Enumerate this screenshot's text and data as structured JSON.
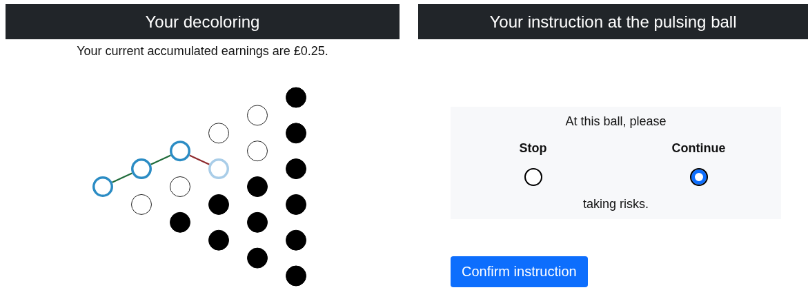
{
  "left_panel": {
    "title": "Your decoloring",
    "earnings": "Your current accumulated earnings are £0.25.",
    "ball_columns": [
      [
        {
          "kind": "path"
        }
      ],
      [
        {
          "kind": "path"
        },
        {
          "kind": "open"
        }
      ],
      [
        {
          "kind": "path"
        },
        {
          "kind": "open"
        },
        {
          "kind": "filled"
        }
      ],
      [
        {
          "kind": "open"
        },
        {
          "kind": "current"
        },
        {
          "kind": "filled"
        },
        {
          "kind": "filled"
        }
      ],
      [
        {
          "kind": "open"
        },
        {
          "kind": "open"
        },
        {
          "kind": "filled"
        },
        {
          "kind": "filled"
        },
        {
          "kind": "filled"
        }
      ],
      [
        {
          "kind": "filled"
        },
        {
          "kind": "filled"
        },
        {
          "kind": "filled"
        },
        {
          "kind": "filled"
        },
        {
          "kind": "filled"
        },
        {
          "kind": "filled"
        }
      ]
    ],
    "links": [
      {
        "color": "#1f6b3a"
      },
      {
        "color": "#1f6b3a"
      },
      {
        "color": "#8e2a2e"
      }
    ]
  },
  "right_panel": {
    "title": "Your instruction at the pulsing ball",
    "prompt": "At this ball, please",
    "choices": [
      {
        "label": "Stop",
        "selected": false
      },
      {
        "label": "Continue",
        "selected": true
      }
    ],
    "suffix": "taking risks.",
    "button": "Confirm instruction"
  }
}
